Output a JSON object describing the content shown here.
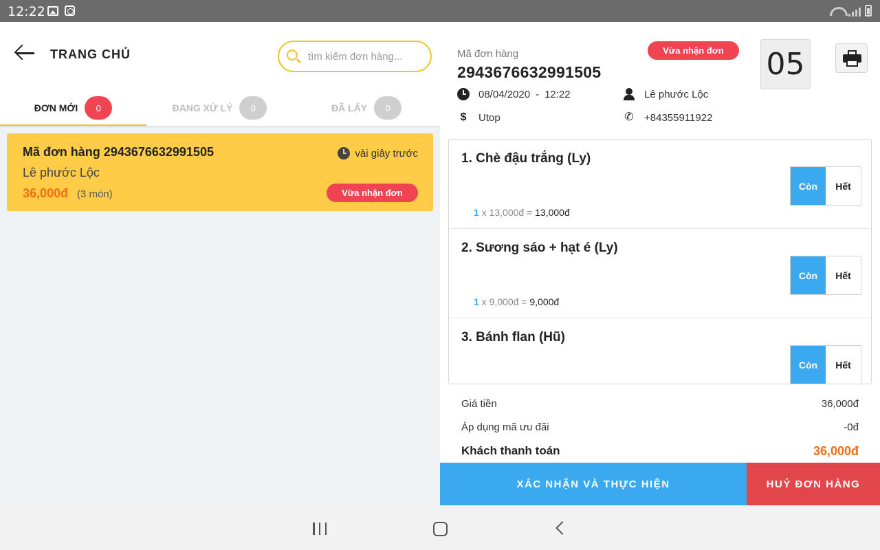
{
  "status_bar": {
    "time": "12:22"
  },
  "header": {
    "title": "TRANG CHỦ",
    "search_placeholder": "tìm kiếm đơn hàng..."
  },
  "tabs": [
    {
      "label": "ĐƠN MỚI",
      "count": "0",
      "active": true
    },
    {
      "label": "ĐANG XỬ LÝ",
      "count": "0",
      "active": false
    },
    {
      "label": "ĐÃ LẤY",
      "count": "0",
      "active": false
    }
  ],
  "order_card": {
    "title": "Mã đơn hàng 2943676632991505",
    "time_ago": "vài giây trước",
    "customer": "Lê phước Lộc",
    "price": "36,000đ",
    "item_count": "(3 món)",
    "status": "Vừa nhận đơn"
  },
  "detail": {
    "order_label": "Mã đơn hàng",
    "order_id": "2943676632991505",
    "status": "Vừa nhận đơn",
    "order_number": "05",
    "date": "08/04/2020",
    "time_sep": "-",
    "time": "12:22",
    "customer": "Lê phước Lộc",
    "payment": "Utop",
    "phone": "+84355911922",
    "items": [
      {
        "name": "1. Chè đậu trắng (Ly)",
        "qty": "1",
        "unit": "x 13,000đ =",
        "total": "13,000đ",
        "on_label": "Còn",
        "off_label": "Hết"
      },
      {
        "name": "2. Sương sáo + hạt é (Ly)",
        "qty": "1",
        "unit": "x 9,000đ =",
        "total": "9,000đ",
        "on_label": "Còn",
        "off_label": "Hết"
      },
      {
        "name": "3. Bánh flan (Hũ)",
        "on_label": "Còn",
        "off_label": "Hết"
      }
    ],
    "summary": {
      "price_label": "Giá tiền",
      "price_value": "36,000đ",
      "discount_label": "Áp dụng mã ưu đãi",
      "discount_value": "-0đ",
      "total_label": "Khách thanh toán",
      "total_value": "36,000đ"
    },
    "confirm_label": "XÁC NHẬN VÀ THỰC HIỆN",
    "cancel_label": "HUỶ ĐƠN HÀNG"
  },
  "colors": {
    "accent": "#3aa9ef",
    "warning": "#fecc47",
    "danger": "#f04452",
    "price": "#f26e14"
  }
}
